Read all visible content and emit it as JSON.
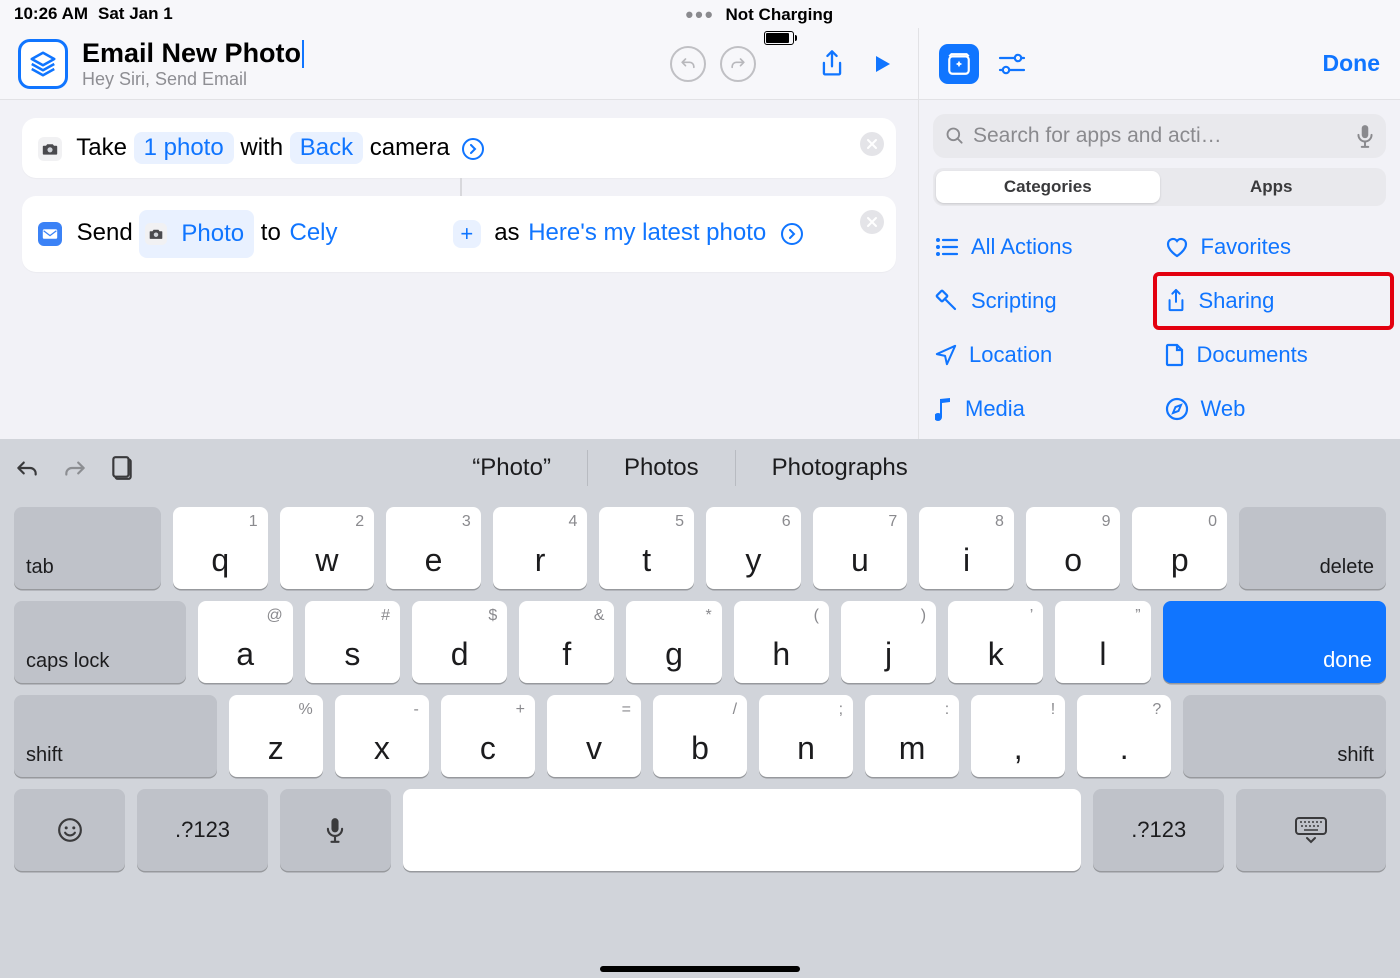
{
  "statusbar": {
    "time": "10:26 AM",
    "date": "Sat Jan 1",
    "charging": "Not Charging"
  },
  "header": {
    "title": "Email New Photo",
    "subtitle": "Hey Siri, Send Email"
  },
  "actions": [
    {
      "prefix": "Take",
      "token1": "1 photo",
      "mid": "with",
      "token2": "Back",
      "suffix": "camera"
    },
    {
      "prefix": "Send",
      "photoToken": "Photo",
      "to": "to",
      "recipient": "Cely",
      "as": "as",
      "body": "Here's my latest photo"
    }
  ],
  "rightPanel": {
    "doneLabel": "Done",
    "searchPlaceholder": "Search for apps and acti…",
    "segments": {
      "a": "Categories",
      "b": "Apps"
    },
    "categories": [
      "All Actions",
      "Favorites",
      "Scripting",
      "Sharing",
      "Location",
      "Documents",
      "Media",
      "Web"
    ]
  },
  "plus": "+",
  "keyboard": {
    "suggestions": [
      "“Photo”",
      "Photos",
      "Photographs"
    ],
    "row1sec": [
      "1",
      "2",
      "3",
      "4",
      "5",
      "6",
      "7",
      "8",
      "9",
      "0"
    ],
    "row1": [
      "q",
      "w",
      "e",
      "r",
      "t",
      "y",
      "u",
      "i",
      "o",
      "p"
    ],
    "row2sec": [
      "@",
      "#",
      "$",
      "&",
      "*",
      "(",
      ")",
      "’",
      "”"
    ],
    "row2": [
      "a",
      "s",
      "d",
      "f",
      "g",
      "h",
      "j",
      "k",
      "l"
    ],
    "row3sec": [
      "%",
      "-",
      "+",
      "=",
      "/",
      ";",
      ":",
      "!",
      "?"
    ],
    "row3": [
      "z",
      "x",
      "c",
      "v",
      "b",
      "n",
      "m",
      ",",
      "."
    ],
    "tab": "tab",
    "delete": "delete",
    "caps": "caps lock",
    "done": "done",
    "shift": "shift",
    "numsym": ".?123"
  }
}
